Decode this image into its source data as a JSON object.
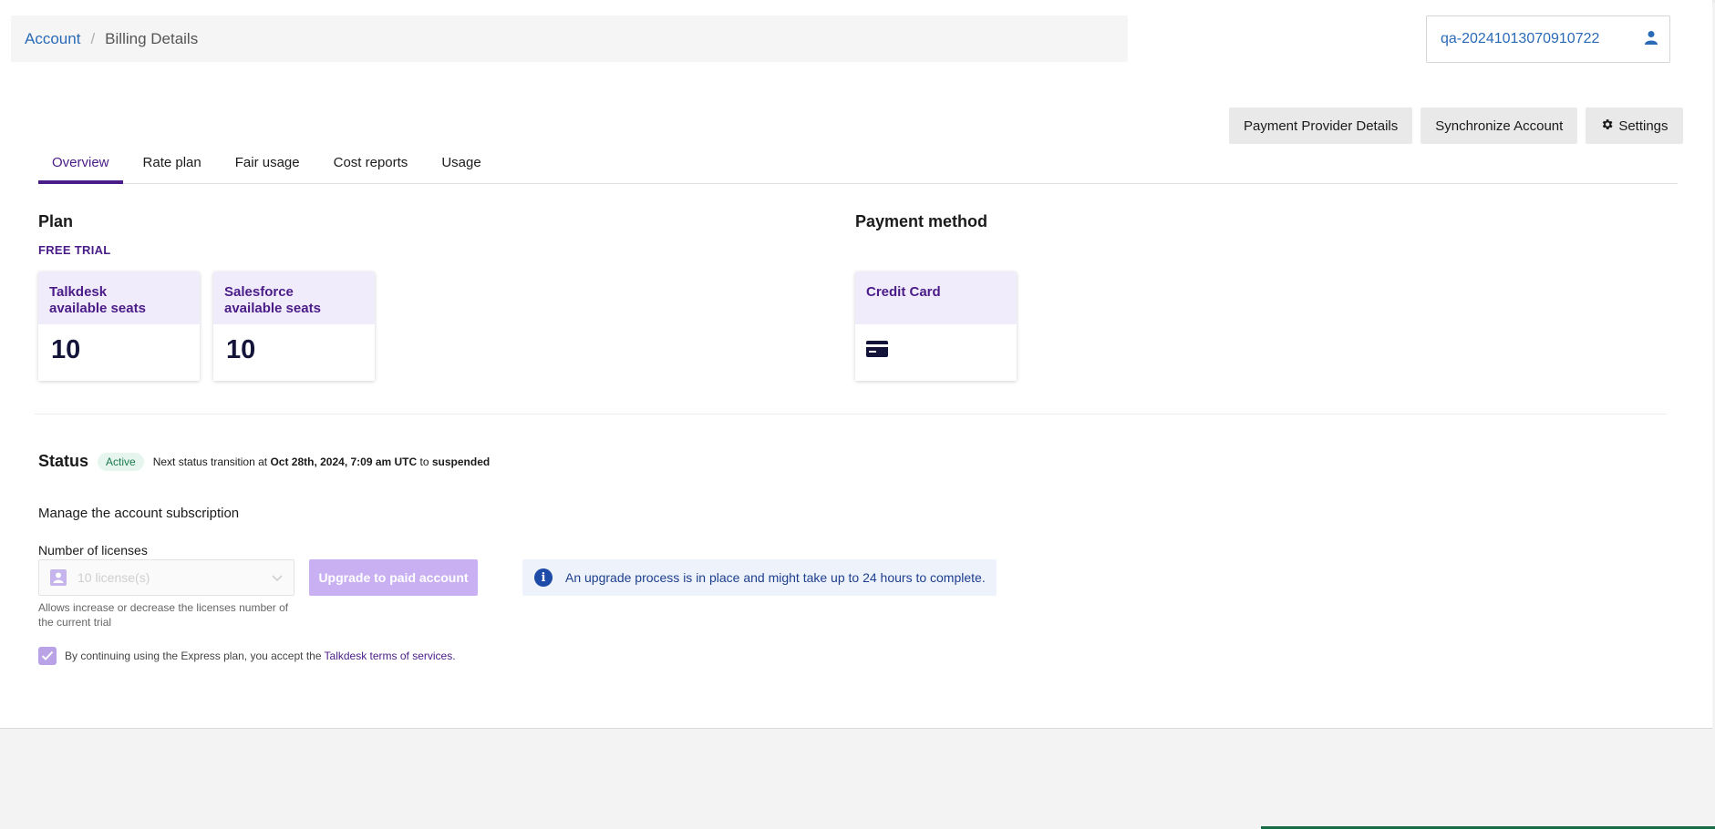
{
  "breadcrumb": {
    "root": "Account",
    "separator": "/",
    "current": "Billing Details"
  },
  "account": {
    "name": "qa-20241013070910722",
    "icon": "user-icon"
  },
  "actions": {
    "payment_provider": "Payment Provider Details",
    "synchronize": "Synchronize Account",
    "settings": "Settings",
    "settings_icon": "gear-icon"
  },
  "tabs": [
    {
      "label": "Overview",
      "active": true
    },
    {
      "label": "Rate plan",
      "active": false
    },
    {
      "label": "Fair usage",
      "active": false
    },
    {
      "label": "Cost reports",
      "active": false
    },
    {
      "label": "Usage",
      "active": false
    }
  ],
  "plan": {
    "title": "Plan",
    "type": "FREE TRIAL",
    "cards": [
      {
        "title_line1": "Talkdesk",
        "title_line2": "available seats",
        "value": "10"
      },
      {
        "title_line1": "Salesforce",
        "title_line2": "available seats",
        "value": "10"
      }
    ]
  },
  "payment": {
    "title": "Payment method",
    "card_title": "Credit Card",
    "icon": "credit-card-icon"
  },
  "status": {
    "title": "Status",
    "badge": "Active",
    "text_prefix": "Next status transition at",
    "date": "Oct 28th, 2024, 7:09 am UTC",
    "text_mid": "to",
    "next_state": "suspended"
  },
  "subscription": {
    "manage_label": "Manage the account subscription",
    "licenses_label": "Number of licenses",
    "licenses_value": "10 license(s)",
    "upgrade_button": "Upgrade to paid account",
    "help_text": "Allows increase or decrease the licenses number of the current trial",
    "terms_prefix": "By continuing using the Express plan, you accept the",
    "terms_link": "Talkdesk terms of services."
  },
  "info": {
    "icon": "info-icon",
    "text": "An upgrade process is in place and might take up to 24 hours to complete."
  },
  "colors": {
    "accent": "#4a1c88",
    "link": "#2a6ab7",
    "upgrade_disabled": "#c8b0f2",
    "info_bg": "#eef3fb"
  }
}
